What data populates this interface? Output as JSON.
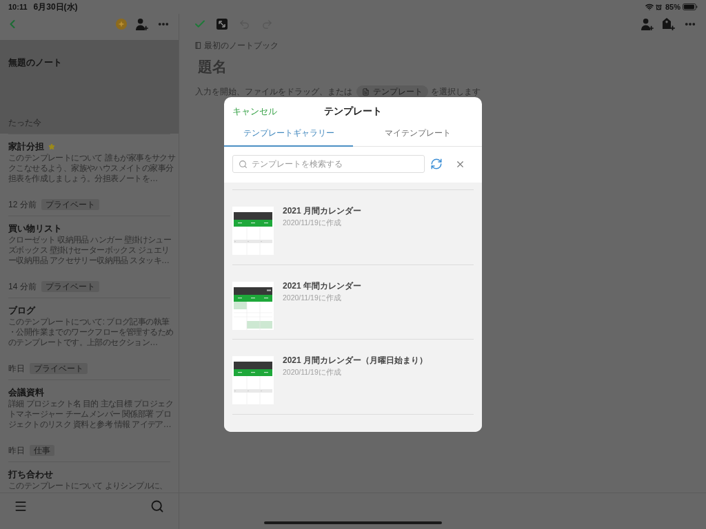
{
  "status_bar": {
    "time": "10:11",
    "date": "6月30日(水)",
    "battery": "85%"
  },
  "sidebar": {
    "notes": [
      {
        "title": "無題のノート",
        "time": "たった今",
        "selected": true,
        "starred": false
      },
      {
        "title": "家計分担",
        "snippet": "このテンプレートについて 誰もが家事をサクサクこなせるよう、家族やハウスメイトの家事分担表を作成しましょう。分担表ノートを…",
        "time": "12 分前",
        "tag": "プライベート",
        "selected": false,
        "starred": true
      },
      {
        "title": "買い物リスト",
        "snippet": "クローゼット 収納用品 ハンガー 壁掛けシューズボックス 壁掛けセーターボックス ジュエリー収納用品 アクセサリー収納用品 スタッキ…",
        "time": "14 分前",
        "tag": "プライベート",
        "selected": false,
        "starred": false
      },
      {
        "title": "ブログ",
        "snippet": "このテンプレートについて: ブログ記事の執筆・公開作業までのワークフローを管理するためのテンプレートです。上部のセクション…",
        "time": "昨日",
        "tag": "プライベート",
        "selected": false,
        "starred": false
      },
      {
        "title": "会議資料",
        "snippet": "詳細 プロジェクト名 目的 主な目標 プロジェクトマネージャー チームメンバー 関係部署 プロジェクトのリスク 資料と参考 情報 アイデア…",
        "time": "昨日",
        "tag": "仕事",
        "selected": false,
        "starred": false
      },
      {
        "title": "打ち合わせ",
        "snippet": "このテンプレートについて よりシンプルに、",
        "selected": false,
        "starred": false
      }
    ]
  },
  "editor": {
    "undo": {
      "disabled": true
    },
    "redo": {
      "disabled": true
    },
    "notebook": "最初のノートブック",
    "title_field": {
      "placeholder": "題名"
    },
    "hint": {
      "before": "入力を開始、ファイルをドラッグ、または",
      "button": "テンプレート",
      "after": "を選択します"
    }
  },
  "modal": {
    "cancel": "キャンセル",
    "title": "テンプレート",
    "tabs": [
      {
        "label": "テンプレートギャラリー",
        "selected": true
      },
      {
        "label": "マイテンプレート",
        "selected": false
      }
    ],
    "search": {
      "placeholder": "テンプレートを検索する"
    },
    "templates": [
      {
        "title": "2021 月間カレンダー",
        "created": "2020/11/19に作成",
        "kind": "monthly"
      },
      {
        "title": "2021 年間カレンダー",
        "created": "2020/11/19に作成",
        "kind": "yearly"
      },
      {
        "title": "2021 月間カレンダー（月曜日始まり）",
        "created": "2020/11/19に作成",
        "kind": "monthly"
      }
    ]
  }
}
